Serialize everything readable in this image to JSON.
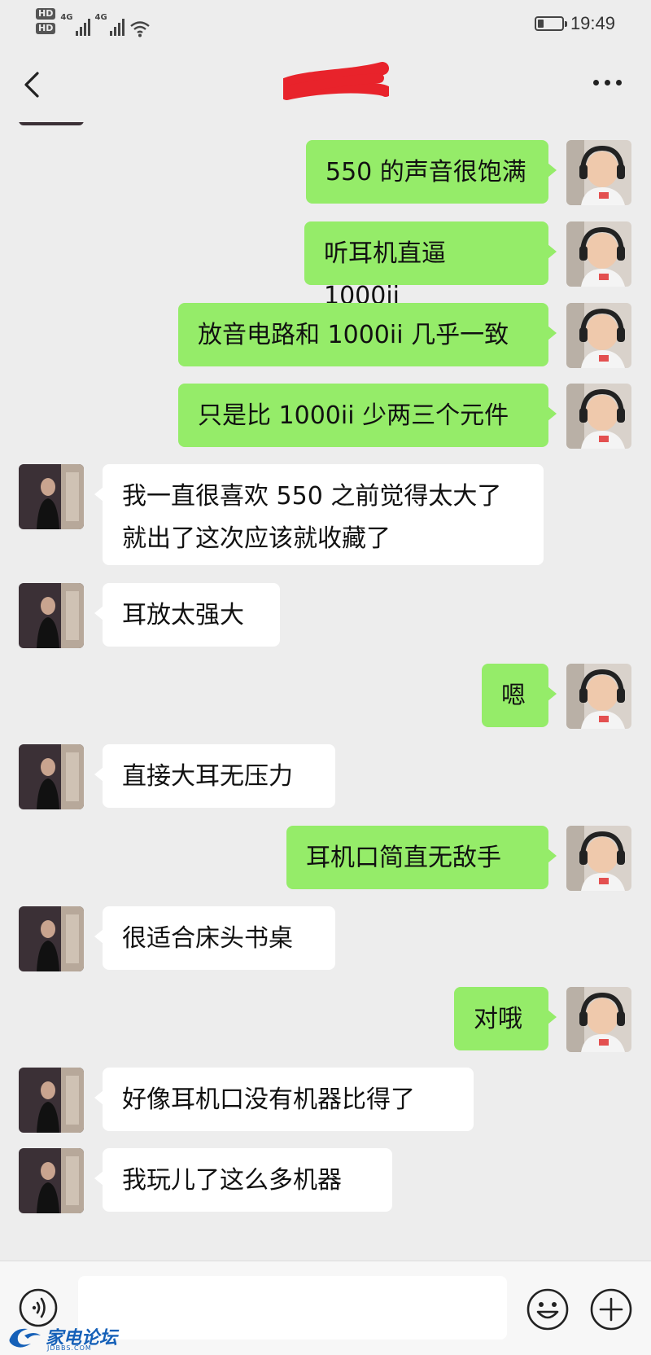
{
  "status_bar": {
    "time": "19:49",
    "hd1": "HD",
    "hd2": "HD",
    "network1": "4G",
    "network2": "4G",
    "battery_level": 0.25
  },
  "header": {
    "title": "",
    "back_icon": "chevron-left-icon",
    "more_icon": "more-dots-icon"
  },
  "messages": [
    {
      "side": "right",
      "text": "550 的声音很饱满"
    },
    {
      "side": "right",
      "text": "听耳机直逼 1000ii"
    },
    {
      "side": "right",
      "text": "放音电路和 1000ii 几乎一致"
    },
    {
      "side": "right",
      "text": "只是比 1000ii 少两三个元件"
    },
    {
      "side": "left",
      "text": "我一直很喜欢 550 之前觉得太大了\n就出了这次应该就收藏了"
    },
    {
      "side": "left",
      "text": "耳放太强大"
    },
    {
      "side": "right",
      "text": "嗯"
    },
    {
      "side": "left",
      "text": "直接大耳无压力"
    },
    {
      "side": "right",
      "text": "耳机口简直无敌手"
    },
    {
      "side": "left",
      "text": "很适合床头书桌"
    },
    {
      "side": "right",
      "text": "对哦"
    },
    {
      "side": "left",
      "text": "好像耳机口没有机器比得了"
    },
    {
      "side": "left",
      "text": "我玩儿了这么多机器"
    }
  ],
  "input_bar": {
    "value": "",
    "voice_icon": "voice-icon",
    "emoji_icon": "emoji-icon",
    "plus_icon": "plus-icon"
  },
  "watermark": {
    "text": "家电论坛",
    "sub": "JDBBS.COM"
  },
  "colors": {
    "background": "#ededed",
    "sent_bubble": "#95ec69",
    "received_bubble": "#ffffff"
  }
}
